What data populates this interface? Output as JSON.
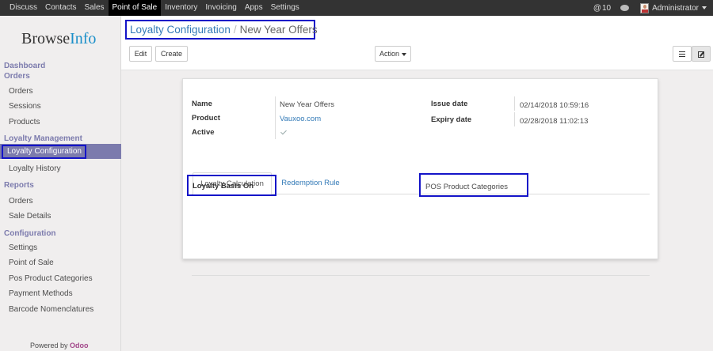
{
  "topbar": {
    "menu": [
      "Discuss",
      "Contacts",
      "Sales",
      "Point of Sale",
      "Inventory",
      "Invoicing",
      "Apps",
      "Settings"
    ],
    "active_index": 3,
    "notification_count": "10",
    "user": "Administrator"
  },
  "sidebar": {
    "logo_main": "Browse",
    "logo_accent": "Info",
    "sections": {
      "dashboard": "Dashboard",
      "orders": "Orders",
      "loyalty": "Loyalty Management",
      "reports": "Reports",
      "configuration": "Configuration"
    },
    "items": {
      "orders": "Orders",
      "sessions": "Sessions",
      "products": "Products",
      "loyalty_config": "Loyalty Configuration",
      "loyalty_history": "Loyalty History",
      "report_orders": "Orders",
      "sale_details": "Sale Details",
      "settings": "Settings",
      "point_of_sale": "Point of Sale",
      "pos_product_categories": "Pos Product Categories",
      "payment_methods": "Payment Methods",
      "barcode_nomenclatures": "Barcode Nomenclatures"
    },
    "powered_by": "Powered by",
    "powered_brand": "Odoo"
  },
  "breadcrumb": {
    "parent": "Loyalty Configuration",
    "separator": "/",
    "current": "New Year Offers"
  },
  "toolbar": {
    "edit": "Edit",
    "create": "Create",
    "action": "Action"
  },
  "form": {
    "name_label": "Name",
    "name_value": "New Year Offers",
    "product_label": "Product",
    "product_value": "Vauxoo.com",
    "active_label": "Active",
    "active_checked": true,
    "issue_label": "Issue date",
    "issue_value": "02/14/2018 10:59:16",
    "expiry_label": "Expiry date",
    "expiry_value": "02/28/2018 11:02:13"
  },
  "tabs": {
    "calc": "Loyalty Calculation",
    "redemption": "Redemption Rule"
  },
  "tab_content": {
    "basis_label": "Loyalty Basis On",
    "basis_value": "POS Product Categories"
  }
}
